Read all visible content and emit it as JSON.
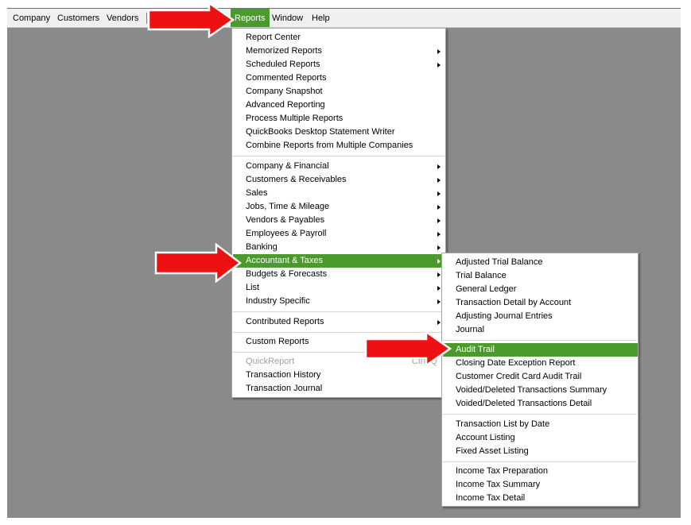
{
  "menubar": {
    "items": [
      {
        "label": "Company"
      },
      {
        "label": "Customers"
      },
      {
        "label": "Vendors"
      },
      {
        "label": "Reports"
      },
      {
        "label": "Window"
      },
      {
        "label": "Help"
      }
    ]
  },
  "reports_menu": {
    "group1": [
      {
        "label": "Report Center"
      },
      {
        "label": "Memorized Reports"
      },
      {
        "label": "Scheduled Reports"
      },
      {
        "label": "Commented Reports"
      },
      {
        "label": "Company Snapshot"
      },
      {
        "label": "Advanced Reporting"
      },
      {
        "label": "Process Multiple Reports"
      },
      {
        "label": "QuickBooks Desktop Statement Writer"
      },
      {
        "label": "Combine Reports from Multiple Companies"
      }
    ],
    "group2": [
      {
        "label": "Company & Financial"
      },
      {
        "label": "Customers & Receivables"
      },
      {
        "label": "Sales"
      },
      {
        "label": "Jobs, Time & Mileage"
      },
      {
        "label": "Vendors & Payables"
      },
      {
        "label": "Employees & Payroll"
      },
      {
        "label": "Banking"
      },
      {
        "label": "Accountant & Taxes"
      },
      {
        "label": "Budgets & Forecasts"
      },
      {
        "label": "List"
      },
      {
        "label": "Industry Specific"
      }
    ],
    "group3": [
      {
        "label": "Contributed Reports"
      }
    ],
    "group4": [
      {
        "label": "Custom Reports"
      }
    ],
    "group5": [
      {
        "label": "QuickReport",
        "shortcut": "Ctrl+Q"
      },
      {
        "label": "Transaction History"
      },
      {
        "label": "Transaction Journal"
      }
    ]
  },
  "accountant_menu": {
    "group1": [
      {
        "label": "Adjusted Trial Balance"
      },
      {
        "label": "Trial Balance"
      },
      {
        "label": "General Ledger"
      },
      {
        "label": "Transaction Detail by Account"
      },
      {
        "label": "Adjusting Journal Entries"
      },
      {
        "label": "Journal"
      }
    ],
    "group2": [
      {
        "label": "Audit Trail"
      },
      {
        "label": "Closing Date Exception Report"
      },
      {
        "label": "Customer Credit Card Audit Trail"
      },
      {
        "label": "Voided/Deleted Transactions Summary"
      },
      {
        "label": "Voided/Deleted Transactions Detail"
      }
    ],
    "group3": [
      {
        "label": "Transaction List by Date"
      },
      {
        "label": "Account Listing"
      },
      {
        "label": "Fixed Asset Listing"
      }
    ],
    "group4": [
      {
        "label": "Income Tax Preparation"
      },
      {
        "label": "Income Tax Summary"
      },
      {
        "label": "Income Tax Detail"
      }
    ]
  },
  "colors": {
    "highlight": "#4a9b2b",
    "background": "#8a8a8a",
    "menubar": "#f0f0f0",
    "annotation_arrow": "#ee1111"
  }
}
